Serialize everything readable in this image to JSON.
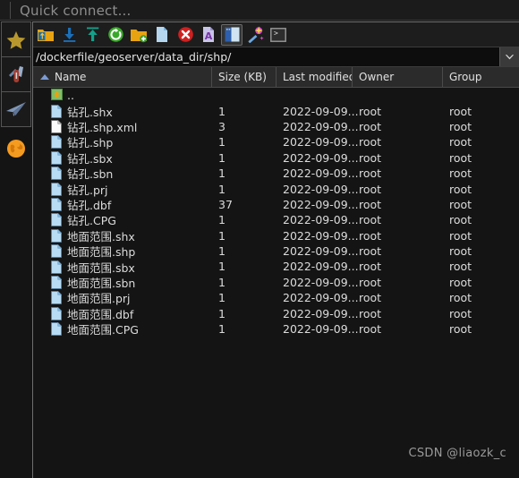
{
  "quick_connect": {
    "placeholder": "Quick connect..."
  },
  "sidebar": {
    "items": [
      {
        "name": "bookmarks",
        "icon": "star-icon",
        "color": "#b8982e"
      },
      {
        "name": "tools",
        "icon": "swiss-knife-icon",
        "color": "#b0453a"
      },
      {
        "name": "send",
        "icon": "paper-plane-icon",
        "color": "#7a93b5"
      },
      {
        "name": "globe",
        "icon": "globe-icon",
        "color": "#f08c1a"
      }
    ]
  },
  "toolbar": {
    "buttons": [
      {
        "name": "open-folder-button",
        "icon": "folder-up-icon",
        "label": "Open folder"
      },
      {
        "name": "download-button",
        "icon": "download-arrow-icon",
        "label": "Download"
      },
      {
        "name": "upload-button",
        "icon": "upload-arrow-icon",
        "label": "Upload"
      },
      {
        "name": "refresh-button",
        "icon": "refresh-circle-icon",
        "label": "Refresh"
      },
      {
        "name": "new-folder-button",
        "icon": "folder-plus-icon",
        "label": "New folder"
      },
      {
        "name": "new-file-button",
        "icon": "new-file-icon",
        "label": "New file"
      },
      {
        "name": "delete-button",
        "icon": "delete-x-icon",
        "label": "Delete"
      },
      {
        "name": "edit-text-button",
        "icon": "text-edit-icon",
        "label": "Edit"
      },
      {
        "name": "split-view-button",
        "icon": "split-pane-icon",
        "label": "Split view",
        "active": true
      },
      {
        "name": "magic-wand-button",
        "icon": "magic-wand-icon",
        "label": "Tools"
      },
      {
        "name": "terminal-button",
        "icon": "terminal-icon",
        "label": "Terminal"
      }
    ]
  },
  "path_bar": {
    "value": "/dockerfile/geoserver/data_dir/shp/",
    "dropdown_icon": "chevron-down-icon"
  },
  "file_list": {
    "columns": [
      {
        "key": "name",
        "label": "Name",
        "sorted": "asc"
      },
      {
        "key": "size",
        "label": "Size (KB)"
      },
      {
        "key": "modified",
        "label": "Last modified"
      },
      {
        "key": "owner",
        "label": "Owner"
      },
      {
        "key": "group",
        "label": "Group"
      }
    ],
    "parent_row": {
      "name": "..",
      "icon": "folder-up-icon"
    },
    "rows": [
      {
        "name": "钻孔.shx",
        "icon": "file-blue-icon",
        "size": "1",
        "modified": "2022-09-09...",
        "owner": "root",
        "group": "root"
      },
      {
        "name": "钻孔.shp.xml",
        "icon": "file-white-icon",
        "size": "3",
        "modified": "2022-09-09...",
        "owner": "root",
        "group": "root"
      },
      {
        "name": "钻孔.shp",
        "icon": "file-blue-icon",
        "size": "1",
        "modified": "2022-09-09...",
        "owner": "root",
        "group": "root"
      },
      {
        "name": "钻孔.sbx",
        "icon": "file-blue-icon",
        "size": "1",
        "modified": "2022-09-09...",
        "owner": "root",
        "group": "root"
      },
      {
        "name": "钻孔.sbn",
        "icon": "file-blue-icon",
        "size": "1",
        "modified": "2022-09-09...",
        "owner": "root",
        "group": "root"
      },
      {
        "name": "钻孔.prj",
        "icon": "file-blue-icon",
        "size": "1",
        "modified": "2022-09-09...",
        "owner": "root",
        "group": "root"
      },
      {
        "name": "钻孔.dbf",
        "icon": "file-blue-icon",
        "size": "37",
        "modified": "2022-09-09...",
        "owner": "root",
        "group": "root"
      },
      {
        "name": "钻孔.CPG",
        "icon": "file-blue-icon",
        "size": "1",
        "modified": "2022-09-09...",
        "owner": "root",
        "group": "root"
      },
      {
        "name": "地面范围.shx",
        "icon": "file-blue-icon",
        "size": "1",
        "modified": "2022-09-09...",
        "owner": "root",
        "group": "root"
      },
      {
        "name": "地面范围.shp",
        "icon": "file-blue-icon",
        "size": "1",
        "modified": "2022-09-09...",
        "owner": "root",
        "group": "root"
      },
      {
        "name": "地面范围.sbx",
        "icon": "file-blue-icon",
        "size": "1",
        "modified": "2022-09-09...",
        "owner": "root",
        "group": "root"
      },
      {
        "name": "地面范围.sbn",
        "icon": "file-blue-icon",
        "size": "1",
        "modified": "2022-09-09...",
        "owner": "root",
        "group": "root"
      },
      {
        "name": "地面范围.prj",
        "icon": "file-blue-icon",
        "size": "1",
        "modified": "2022-09-09...",
        "owner": "root",
        "group": "root"
      },
      {
        "name": "地面范围.dbf",
        "icon": "file-blue-icon",
        "size": "1",
        "modified": "2022-09-09...",
        "owner": "root",
        "group": "root"
      },
      {
        "name": "地面范围.CPG",
        "icon": "file-blue-icon",
        "size": "1",
        "modified": "2022-09-09...",
        "owner": "root",
        "group": "root"
      }
    ]
  },
  "watermark": {
    "text": "CSDN @liaozk_c"
  },
  "colors": {
    "background": "#141414",
    "header": "#2b2b2b",
    "accent_blue": "#7a9ad6",
    "text": "#dcdcdc"
  }
}
